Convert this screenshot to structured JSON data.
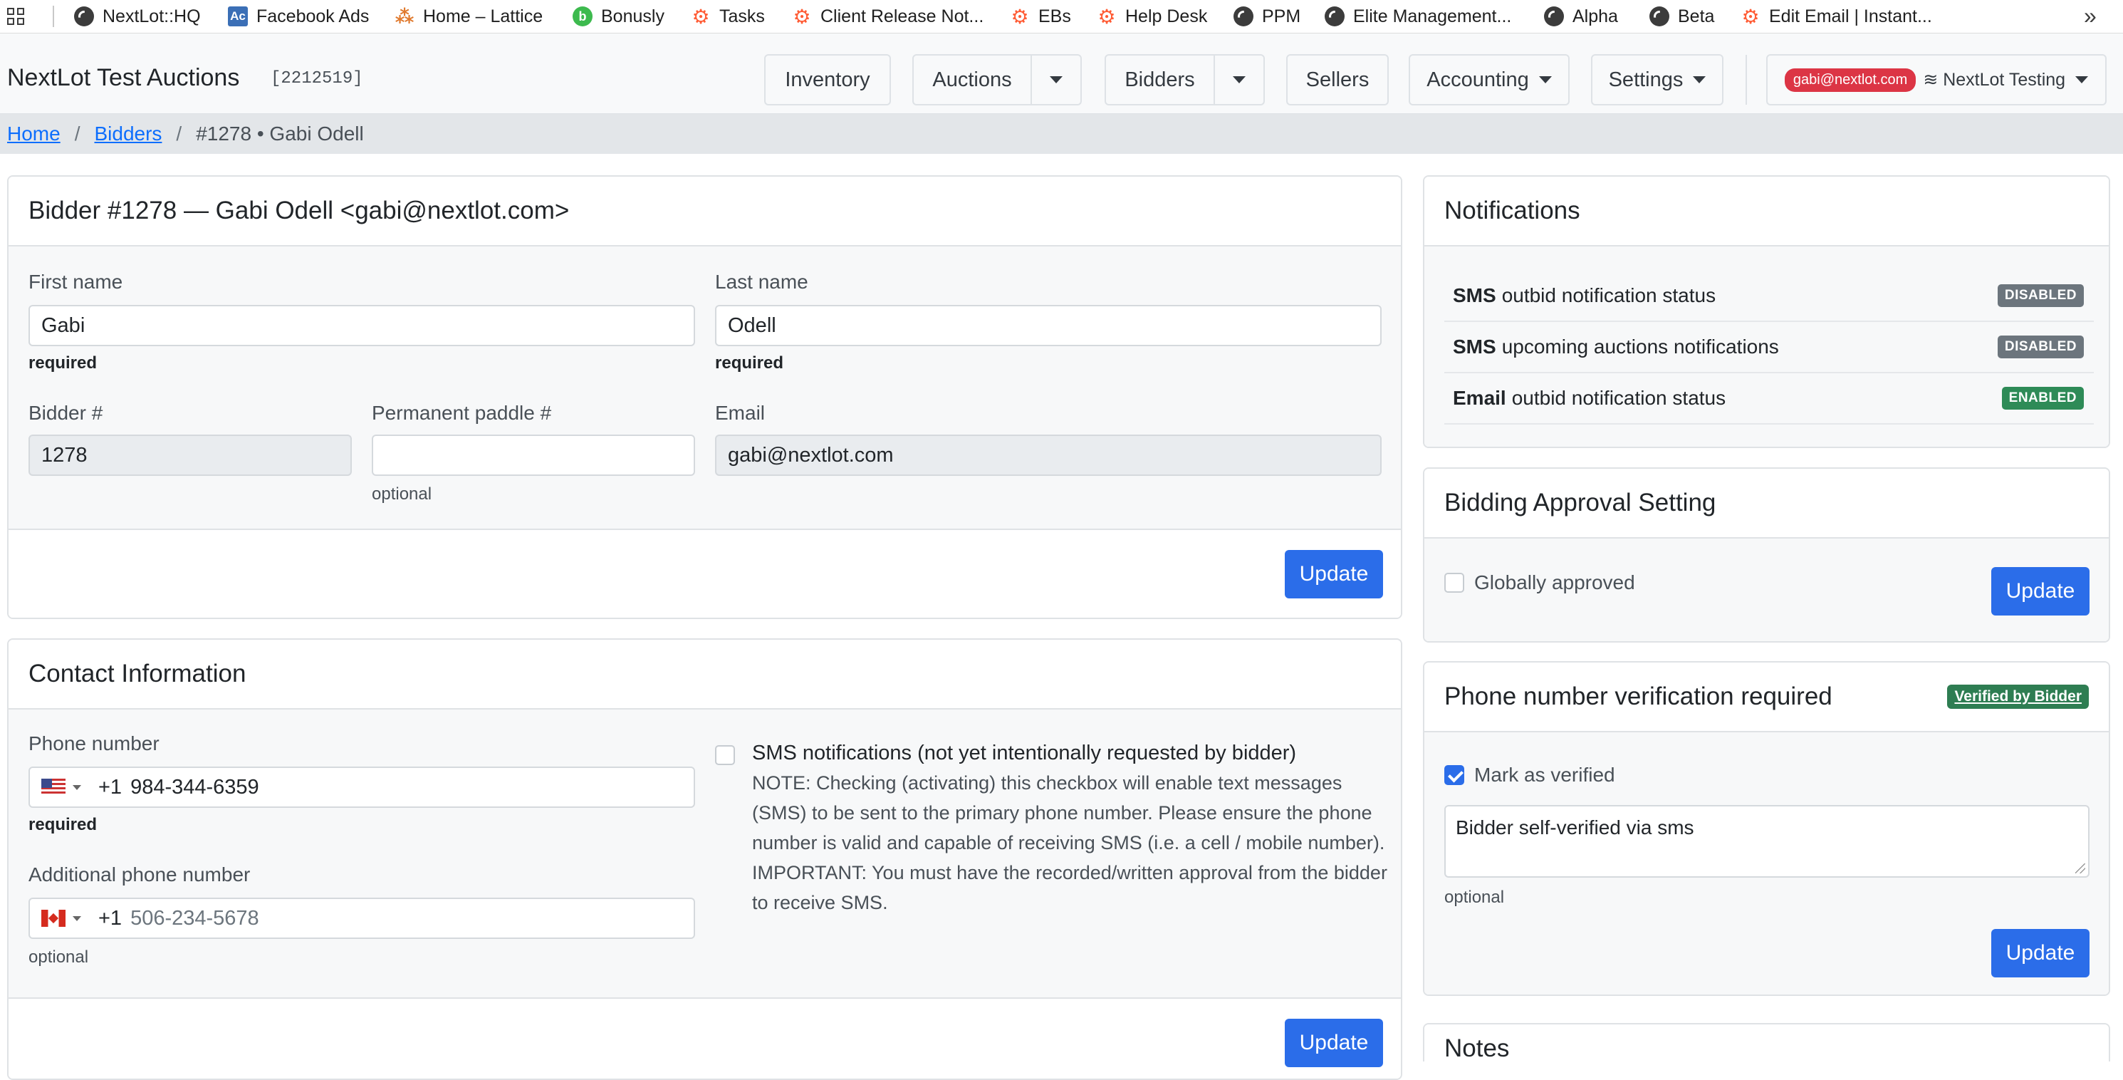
{
  "bookmarks": [
    {
      "label": "NextLot::HQ",
      "icon": "globe-icon"
    },
    {
      "label": "Facebook Ads",
      "icon": "ac-icon"
    },
    {
      "label": "Home – Lattice",
      "icon": "lattice-icon"
    },
    {
      "label": "Bonusly",
      "icon": "bonusly-icon"
    },
    {
      "label": "Tasks",
      "icon": "hubspot-icon"
    },
    {
      "label": "Client Release Not...",
      "icon": "hubspot-icon"
    },
    {
      "label": "EBs",
      "icon": "hubspot-icon"
    },
    {
      "label": "Help Desk",
      "icon": "hubspot-icon"
    },
    {
      "label": "PPM",
      "icon": "globe-icon"
    },
    {
      "label": "Elite Management...",
      "icon": "globe-icon"
    },
    {
      "label": "Alpha",
      "icon": "globe-icon"
    },
    {
      "label": "Beta",
      "icon": "globe-icon"
    },
    {
      "label": "Edit Email | Instant...",
      "icon": "hubspot-icon"
    }
  ],
  "navbar": {
    "brand": "NextLot Test Auctions",
    "account_id": "[2212519]",
    "inventory": "Inventory",
    "auctions": "Auctions",
    "bidders": "Bidders",
    "sellers": "Sellers",
    "accounting": "Accounting",
    "settings": "Settings",
    "user_email": "gabi@nextlot.com",
    "tenant": "≋ NextLot Testing"
  },
  "breadcrumb": {
    "home": "Home",
    "bidders": "Bidders",
    "current": "#1278 • Gabi Odell"
  },
  "bidder_card": {
    "title": "Bidder #1278  — Gabi Odell <gabi@nextlot.com>",
    "first_name_label": "First name",
    "first_name": "Gabi",
    "last_name_label": "Last name",
    "last_name": "Odell",
    "required": "required",
    "bidder_no_label": "Bidder #",
    "bidder_no": "1278",
    "paddle_label": "Permanent paddle #",
    "paddle": "",
    "optional": "optional",
    "email_label": "Email",
    "email": "gabi@nextlot.com",
    "update": "Update"
  },
  "contact_card": {
    "title": "Contact Information",
    "phone_label": "Phone number",
    "phone_dial": "+1",
    "phone": "984-344-6359",
    "required": "required",
    "add_phone_label": "Additional phone number",
    "add_phone_dial": "+1",
    "add_phone_placeholder": "506-234-5678",
    "optional": "optional",
    "sms_title": "SMS notifications (not yet intentionally requested by bidder)",
    "sms_note": "NOTE: Checking (activating) this checkbox will enable text messages (SMS) to be sent to the primary phone number. Please ensure the phone number is valid and capable of receiving SMS (i.e. a cell / mobile number).",
    "sms_important": "IMPORTANT: You must have the recorded/written approval from the bidder to receive SMS.",
    "sms_checked": false,
    "update": "Update"
  },
  "notifications_card": {
    "title": "Notifications",
    "rows": [
      {
        "bold": "SMS",
        "text": "outbid notification status",
        "status": "DISABLED"
      },
      {
        "bold": "SMS",
        "text": "upcoming auctions notifications",
        "status": "DISABLED"
      },
      {
        "bold": "Email",
        "text": "outbid notification status",
        "status": "ENABLED"
      }
    ]
  },
  "approval_card": {
    "title": "Bidding Approval Setting",
    "globally_approved_label": "Globally approved",
    "globally_approved": false,
    "update": "Update"
  },
  "phone_verif_card": {
    "title": "Phone number verification required",
    "badge": "Verified by Bidder",
    "mark_verified_label": "Mark as verified",
    "mark_verified": true,
    "note": "Bidder self-verified via sms",
    "optional": "optional",
    "update": "Update"
  },
  "notes_card": {
    "title": "Notes"
  },
  "colors": {
    "primary": "#2b6de9",
    "danger": "#dc3545",
    "enabled": "#2e8b57",
    "disabled": "#6c757d"
  }
}
